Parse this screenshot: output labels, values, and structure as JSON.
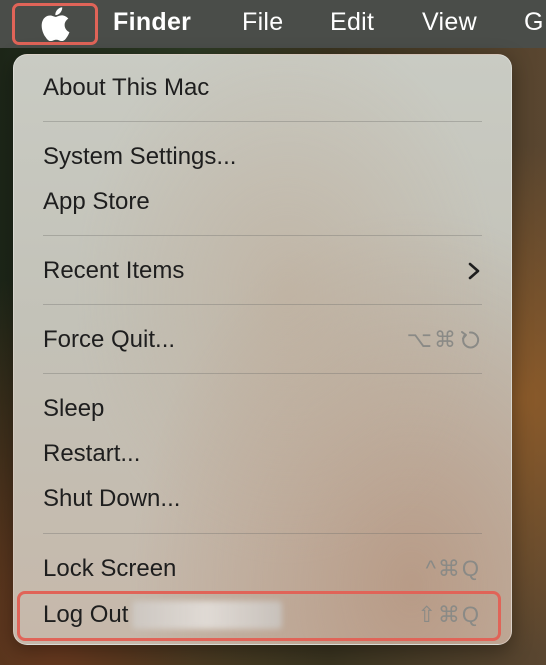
{
  "menubar": {
    "apple_icon": "apple-logo-icon",
    "items": [
      "Finder",
      "File",
      "Edit",
      "View",
      "G"
    ]
  },
  "menu": {
    "about": "About This Mac",
    "system_settings": "System Settings...",
    "app_store": "App Store",
    "recent_items": "Recent Items",
    "force_quit": "Force Quit...",
    "force_quit_shortcut": "⌥⌘",
    "sleep": "Sleep",
    "restart": "Restart...",
    "shut_down": "Shut Down...",
    "lock_screen": "Lock Screen",
    "lock_screen_shortcut": "^⌘Q",
    "log_out": "Log Out",
    "log_out_shortcut": "⇧⌘Q"
  },
  "colors": {
    "highlight": "#e06458",
    "menubar": "#4a4d49"
  }
}
